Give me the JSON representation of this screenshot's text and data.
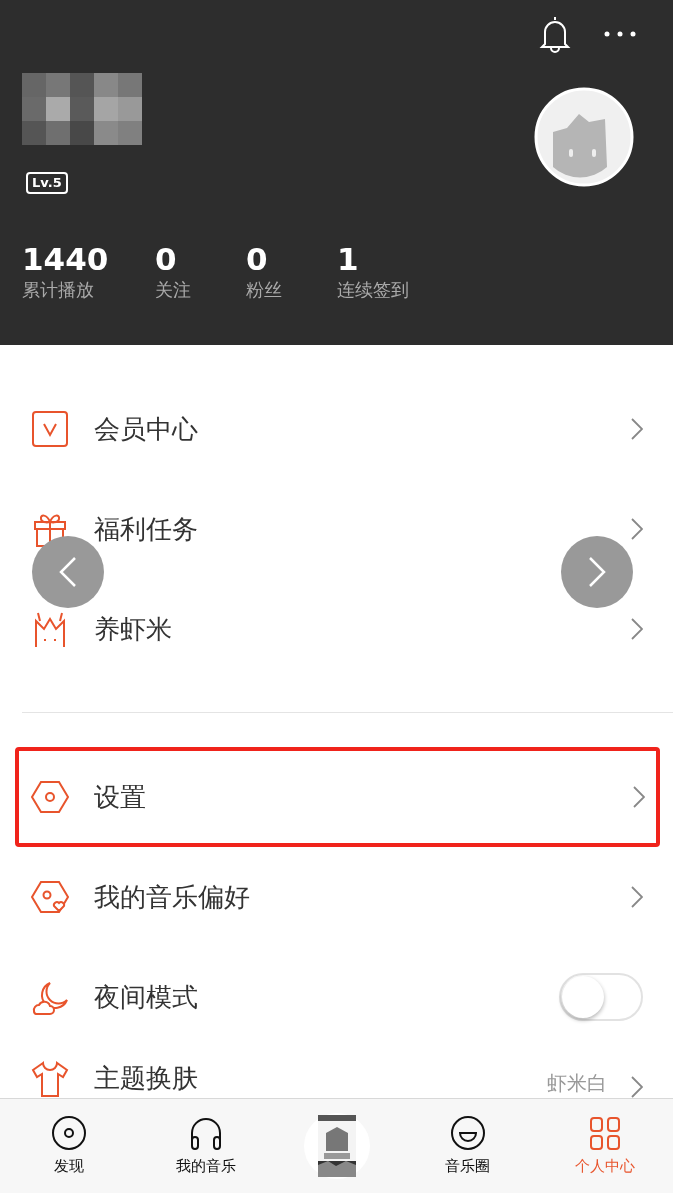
{
  "header": {
    "level_badge": "Lv.5",
    "stats": [
      {
        "value": "1440",
        "label": "累计播放"
      },
      {
        "value": "0",
        "label": "关注"
      },
      {
        "value": "0",
        "label": "粉丝"
      },
      {
        "value": "1",
        "label": "连续签到"
      }
    ]
  },
  "menu_groups": [
    [
      {
        "kind": "link",
        "label": "会员中心",
        "highlighted": false
      },
      {
        "kind": "link",
        "label": "福利任务",
        "highlighted": false
      },
      {
        "kind": "link",
        "label": "养虾米",
        "highlighted": false
      }
    ],
    [
      {
        "kind": "link",
        "label": "设置",
        "highlighted": true
      },
      {
        "kind": "link",
        "label": "我的音乐偏好",
        "highlighted": false
      },
      {
        "kind": "toggle",
        "label": "夜间模式",
        "on": false,
        "highlighted": false
      },
      {
        "kind": "value",
        "label": "主题换肤",
        "value": "虾米白",
        "highlighted": false
      }
    ]
  ],
  "tab_bar": [
    {
      "kind": "icon",
      "label": "发现",
      "selected": false
    },
    {
      "kind": "icon",
      "label": "我的音乐",
      "selected": false
    },
    {
      "kind": "player"
    },
    {
      "kind": "icon",
      "label": "音乐圈",
      "selected": false
    },
    {
      "kind": "icon",
      "label": "个人中心",
      "selected": true
    }
  ]
}
